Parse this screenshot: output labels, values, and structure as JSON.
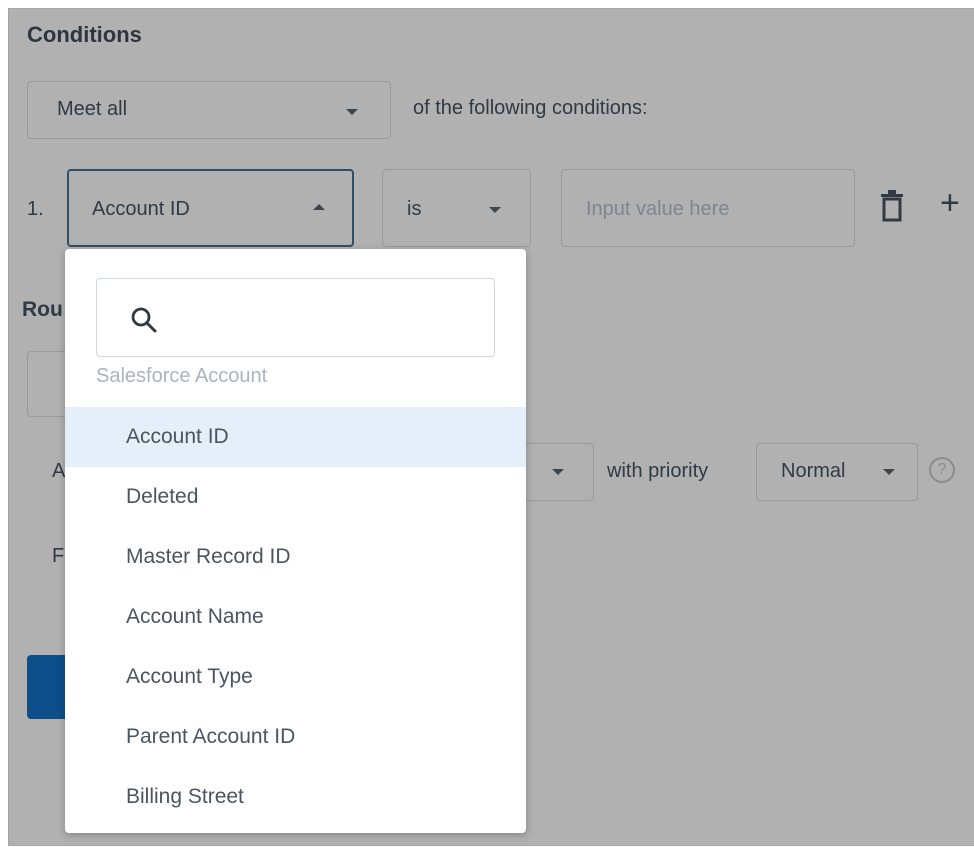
{
  "conditions": {
    "title": "Conditions",
    "match_select": {
      "value": "Meet all"
    },
    "match_suffix": "of the following conditions:",
    "rows": [
      {
        "number": "1.",
        "field": "Account ID",
        "operator": "is",
        "value_placeholder": "Input value here"
      }
    ]
  },
  "background": {
    "section_title_partial": "Rou",
    "row_a_label_partial": "A",
    "row_b_label_partial": "F",
    "with_priority_label": "with priority",
    "priority_value": "Normal",
    "help_glyph": "?"
  },
  "dropdown": {
    "search_placeholder": "",
    "group_label": "Salesforce Account",
    "selected": "Account ID",
    "options": [
      "Account ID",
      "Deleted",
      "Master Record ID",
      "Account Name",
      "Account Type",
      "Parent Account ID",
      "Billing Street"
    ]
  },
  "icons": {
    "search": "search-icon",
    "trash": "trash-icon",
    "plus": "plus-icon",
    "caret_down": "chevron-down-icon",
    "caret_up": "chevron-up-icon",
    "help": "help-icon"
  },
  "colors": {
    "overlay_gray": "#b1b1b1",
    "focus_border": "#2e4f67",
    "selected_option_bg": "#e5eff9",
    "primary_button": "#0d4f8a"
  }
}
